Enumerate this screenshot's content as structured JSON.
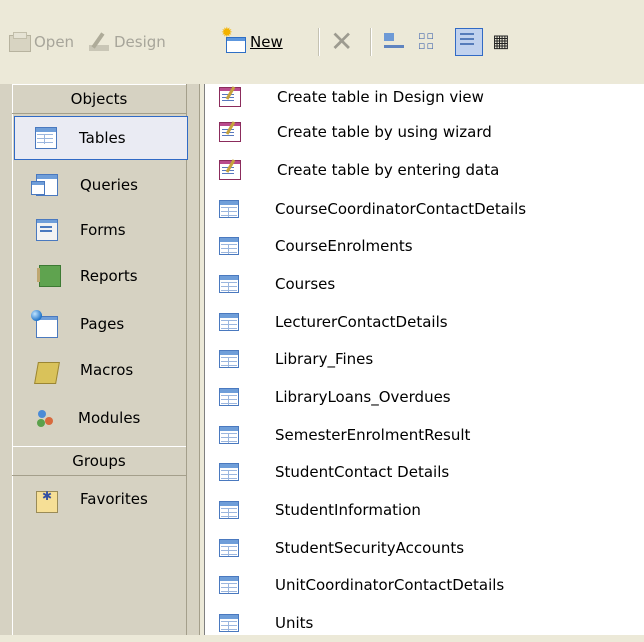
{
  "toolbar": {
    "open_label": "Open",
    "design_label": "Design",
    "new_label": "New",
    "delete_icon": "delete-x-icon",
    "view_icons": [
      "large-icons-view-icon",
      "small-icons-view-icon",
      "list-view-icon",
      "details-view-icon"
    ]
  },
  "objects_bar": {
    "objects_header": "Objects",
    "items": [
      {
        "label": "Tables",
        "icon": "table-icon",
        "selected": true
      },
      {
        "label": "Queries",
        "icon": "query-icon"
      },
      {
        "label": "Forms",
        "icon": "form-icon"
      },
      {
        "label": "Reports",
        "icon": "report-icon"
      },
      {
        "label": "Pages",
        "icon": "page-icon"
      },
      {
        "label": "Macros",
        "icon": "macro-icon"
      },
      {
        "label": "Modules",
        "icon": "module-icon"
      }
    ],
    "groups_header": "Groups",
    "groups": [
      {
        "label": "Favorites",
        "icon": "favorites-icon"
      }
    ]
  },
  "list": {
    "items": [
      {
        "label": "Create table in Design view",
        "type": "shortcut"
      },
      {
        "label": "Create table by using wizard",
        "type": "shortcut"
      },
      {
        "label": "Create table by entering data",
        "type": "shortcut"
      },
      {
        "label": "CourseCoordinatorContactDetails",
        "type": "table"
      },
      {
        "label": "CourseEnrolments",
        "type": "table"
      },
      {
        "label": "Courses",
        "type": "table"
      },
      {
        "label": "LecturerContactDetails",
        "type": "table"
      },
      {
        "label": "Library_Fines",
        "type": "table"
      },
      {
        "label": "LibraryLoans_Overdues",
        "type": "table"
      },
      {
        "label": "SemesterEnrolmentResult",
        "type": "table"
      },
      {
        "label": "StudentContact Details",
        "type": "table"
      },
      {
        "label": "StudentInformation",
        "type": "table"
      },
      {
        "label": "StudentSecurityAccounts",
        "type": "table"
      },
      {
        "label": "UnitCoordinatorContactDetails",
        "type": "table"
      },
      {
        "label": "Units",
        "type": "table"
      }
    ]
  },
  "colors": {
    "chrome": "#ece9d8",
    "panel": "#d6d2c2",
    "selection_border": "#316ac5",
    "disabled_text": "#a7a59a"
  }
}
